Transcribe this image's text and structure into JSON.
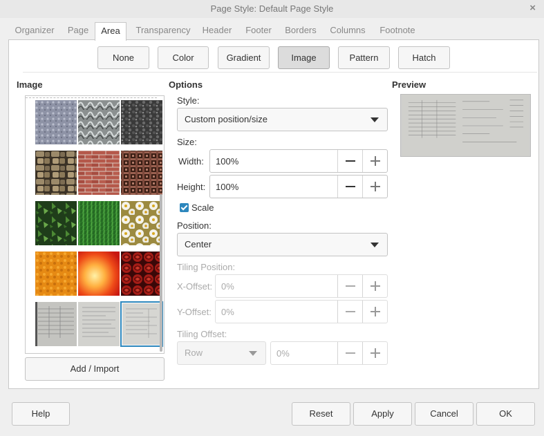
{
  "window": {
    "title": "Page Style: Default Page Style",
    "close_glyph": "×"
  },
  "tabs": [
    {
      "label": "Organizer"
    },
    {
      "label": "Page"
    },
    {
      "label": "Area"
    },
    {
      "label": "Transparency"
    },
    {
      "label": "Header"
    },
    {
      "label": "Footer"
    },
    {
      "label": "Borders"
    },
    {
      "label": "Columns"
    },
    {
      "label": "Footnote"
    }
  ],
  "active_tab": "Area",
  "fill_buttons": [
    {
      "label": "None"
    },
    {
      "label": "Color"
    },
    {
      "label": "Gradient"
    },
    {
      "label": "Image"
    },
    {
      "label": "Pattern"
    },
    {
      "label": "Hatch"
    }
  ],
  "selected_fill": "Image",
  "image_section": {
    "heading": "Image",
    "add_import_label": "Add / Import",
    "thumbnails": [
      {
        "name": "gray-textured-icon"
      },
      {
        "name": "metal-texture-icon"
      },
      {
        "name": "gravel-texture-icon"
      },
      {
        "name": "stone-wall-icon"
      },
      {
        "name": "brick-wall-icon"
      },
      {
        "name": "woven-pattern-icon"
      },
      {
        "name": "ivy-leaves-icon"
      },
      {
        "name": "grass-texture-icon"
      },
      {
        "name": "daisies-icon"
      },
      {
        "name": "orange-texture-icon"
      },
      {
        "name": "fire-texture-icon"
      },
      {
        "name": "red-roses-icon"
      },
      {
        "name": "document-scan-icon"
      },
      {
        "name": "spreadsheet-scan-icon"
      },
      {
        "name": "form-scan-icon"
      }
    ],
    "selected_index": 14
  },
  "options": {
    "heading": "Options",
    "style_label": "Style:",
    "style_value": "Custom position/size",
    "size_label": "Size:",
    "width_label": "Width:",
    "width_value": "100%",
    "height_label": "Height:",
    "height_value": "100%",
    "scale_label": "Scale",
    "scale_checked": true,
    "position_label": "Position:",
    "position_value": "Center",
    "tiling_position_label": "Tiling Position:",
    "x_offset_label": "X-Offset:",
    "x_offset_value": "0%",
    "y_offset_label": "Y-Offset:",
    "y_offset_value": "0%",
    "tiling_offset_label": "Tiling Offset:",
    "tiling_offset_mode": "Row",
    "tiling_offset_value": "0%"
  },
  "preview": {
    "heading": "Preview"
  },
  "footer": {
    "help_label": "Help",
    "reset_label": "Reset",
    "apply_label": "Apply",
    "cancel_label": "Cancel",
    "ok_label": "OK"
  },
  "colors": {
    "accent": "#2d87bd",
    "panel": "#ffffff",
    "dialog_bg": "#efefef"
  }
}
